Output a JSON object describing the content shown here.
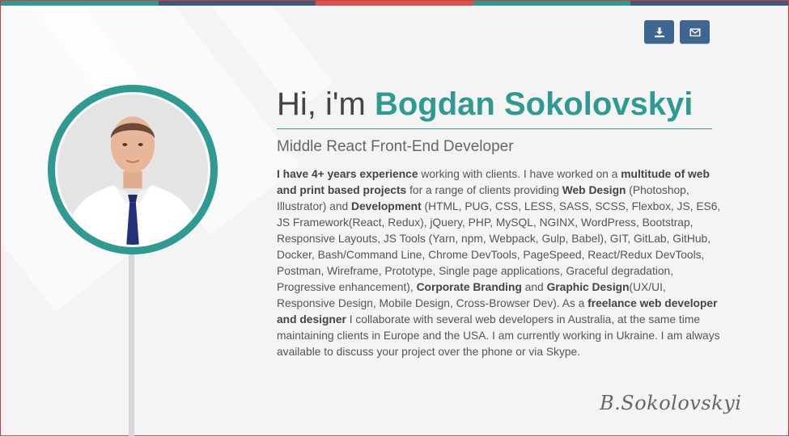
{
  "theme": {
    "accent": "#2e9a91",
    "button": "#3f6591",
    "top_bar_colors": [
      "#2e9a91",
      "#3f5a82",
      "#d9534f",
      "#2e9a91",
      "#3f5a82"
    ]
  },
  "actions": [
    {
      "icon": "download-icon"
    },
    {
      "icon": "envelope-icon"
    }
  ],
  "profile": {
    "greeting": "Hi, i'm",
    "name": "Bogdan Sokolovskyi",
    "role": "Middle React Front-End Developer",
    "signature": "B.Sokolovskyi"
  },
  "bio": [
    {
      "text": "I have 4+ years experience",
      "bold": true
    },
    {
      "text": " working with clients. I have worked on a ",
      "bold": false
    },
    {
      "text": "multitude of web and print based projects",
      "bold": true
    },
    {
      "text": " for a range of clients providing ",
      "bold": false
    },
    {
      "text": "Web Design",
      "bold": true
    },
    {
      "text": " (Photoshop, Illustrator) and ",
      "bold": false
    },
    {
      "text": "Development",
      "bold": true
    },
    {
      "text": " (HTML, PUG, CSS, LESS, SASS, SCSS, Flexbox, JS, ES6, JS Framework(React, Redux), jQuery, PHP, MySQL, NGINX, WordPress, Bootstrap, Responsive Layouts, JS Tools (Yarn, npm, Webpack, Gulp, Babel), GIT, GitLab, GitHub, Docker, Bash/Command Line, Chrome DevTools, PageSpeed, React/Redux DevTools, Postman, Wireframe, Prototype, Single page applications, Graceful degradation, Progressive enhancement), ",
      "bold": false
    },
    {
      "text": "Corporate Branding",
      "bold": true
    },
    {
      "text": " and ",
      "bold": false
    },
    {
      "text": "Graphic Design",
      "bold": true
    },
    {
      "text": "(UX/UI, Responsive Design, Mobile Design, Cross-Browser Dev). As a ",
      "bold": false
    },
    {
      "text": "freelance web developer and designer",
      "bold": true
    },
    {
      "text": " I collaborate with several web developers in Australia, at the same time maintaining clients in Europe and the USA. I am currently working in Ukraine. I am always available to discuss your project over the phone or via Skype.",
      "bold": false
    }
  ]
}
